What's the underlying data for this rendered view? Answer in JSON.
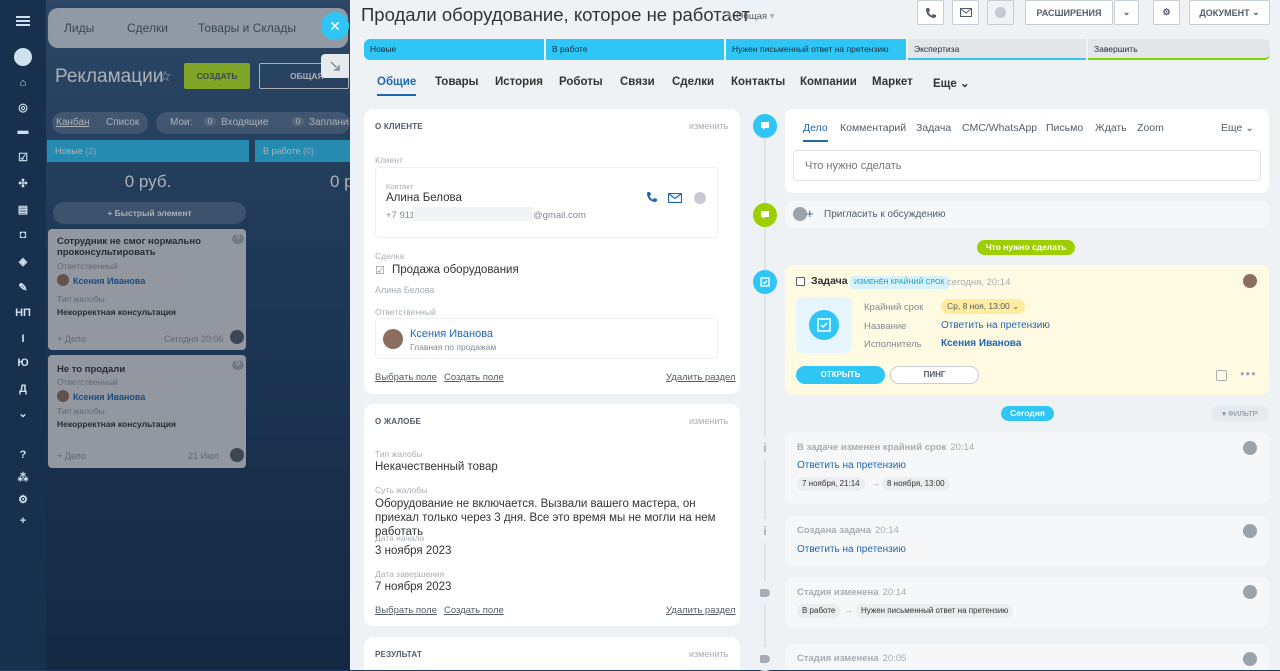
{
  "left_rail": {
    "items": [
      "НП",
      "Ю",
      "Д"
    ]
  },
  "background": {
    "nav": [
      "Лиды",
      "Сделки",
      "Товары и Склады"
    ],
    "title": "Рекламации",
    "create_label": "СОЗДАТЬ",
    "filter_label": "ОБЩАЯ",
    "view_kanban": "Канбан",
    "view_list": "Список",
    "mine_label": "Мои:",
    "incoming_count": "0",
    "incoming_label": "Входящие",
    "planned_count": "0",
    "planned_label": "Заплани",
    "columns": [
      {
        "name": "Новые",
        "count": "(2)",
        "sum": "0 руб."
      },
      {
        "name": "В работе",
        "count": "(0)",
        "sum": "0 р"
      }
    ],
    "quick_add": "+ Быстрый элемент",
    "cards": [
      {
        "title": "Сотрудник не смог нормально проконсультировать",
        "badge": "0",
        "resp_label": "Ответственный",
        "resp": "Ксения Иванова",
        "type_label": "Тип жалобы",
        "type": "Некорректная консультация",
        "deal": "+ Дело",
        "date": "Сегодня 20:06"
      },
      {
        "title": "Не то продали",
        "badge": "0",
        "resp_label": "Ответственный",
        "resp": "Ксения Иванова",
        "type_label": "Тип жалобы",
        "type": "Некорректная консультация",
        "deal": "+ Дело",
        "date": "21 Июл"
      }
    ]
  },
  "header": {
    "title": "Продали оборудование, которое не работает",
    "category": "Общая",
    "ext_label": "РАСШИРЕНИЯ",
    "doc_label": "ДОКУМЕНТ"
  },
  "stages": [
    {
      "label": "Новые",
      "color": "#2fc6f6"
    },
    {
      "label": "В работе",
      "color": "#2fc6f6"
    },
    {
      "label": "Нужен письменный ответ на претензию",
      "color": "#2fc6f6"
    },
    {
      "label": "Экспертиза",
      "color": "#d4d9dd"
    },
    {
      "label": "Завершить",
      "color": "#d4d9dd"
    }
  ],
  "tabs": [
    "Общие",
    "Товары",
    "История",
    "Роботы",
    "Связи",
    "Сделки",
    "Контакты",
    "Компании",
    "Маркет",
    "Еще"
  ],
  "client": {
    "header": "О КЛИЕНТЕ",
    "edit": "изменить",
    "client_label": "Клиент",
    "contact_label": "Контакт",
    "contact_name": "Алина Белова",
    "phone": "+7 911",
    "email_suffix": "@gmail.com",
    "deal_label": "Сделка",
    "deal_name": "Продажа оборудования",
    "deal_contact": "Алина Белова",
    "resp_label": "Ответственный",
    "resp_name": "Ксения Иванова",
    "resp_role": "Главная по продажам",
    "choose_field": "Выбрать поле",
    "create_field": "Создать поле",
    "delete_section": "Удалить раздел"
  },
  "complaint": {
    "header": "О ЖАЛОБЕ",
    "edit": "изменить",
    "type_label": "Тип жалобы",
    "type": "Некачественный товар",
    "essence_label": "Суть жалобы",
    "essence": "Оборудование не включается. Вызвали вашего мастера, он приехал только через 3 дня. Все это время мы не могли на нем работать",
    "start_label": "Дата начала",
    "start": "3 ноября 2023",
    "end_label": "Дата завершения",
    "end": "7 ноября 2023",
    "choose_field": "Выбрать поле",
    "create_field": "Создать поле",
    "delete_section": "Удалить раздел"
  },
  "result": {
    "header": "РЕЗУЛЬТАТ",
    "edit": "изменить"
  },
  "activity": {
    "tabs": [
      "Дело",
      "Комментарий",
      "Задача",
      "СМС/WhatsApp",
      "Письмо",
      "Ждать",
      "Zoom"
    ],
    "more": "Еще",
    "placeholder": "Что нужно сделать",
    "invite": "Пригласить к обсуждению"
  },
  "timeline": {
    "todo_badge": "Что нужно сделать",
    "task": {
      "label": "Задача",
      "tag": "ИЗМЕНЁН КРАЙНИЙ СРОК",
      "time": "сегодня, 20:14",
      "deadline_label": "Крайний срок",
      "deadline": "Ср, 8 ноя, 13:00",
      "name_label": "Название",
      "name": "Ответить на претензию",
      "exec_label": "Исполнитель",
      "exec": "Ксения Иванова",
      "open": "ОТКРЫТЬ",
      "ping": "ПИНГ"
    },
    "today_badge": "Сегодня",
    "filter": "ФИЛЬТР",
    "events": [
      {
        "title": "В задаче изменен крайний срок",
        "time": "20:14",
        "link": "Ответить на претензию",
        "from": "7 ноября, 21:14",
        "to": "8 ноября, 13:00"
      },
      {
        "title": "Создана задача",
        "time": "20:14",
        "link": "Ответить на претензию"
      },
      {
        "title": "Стадия изменена",
        "time": "20:14",
        "from": "В работе",
        "to": "Нужен письменный ответ на претензию"
      },
      {
        "title": "Стадия изменена",
        "time": "20:05"
      }
    ]
  }
}
